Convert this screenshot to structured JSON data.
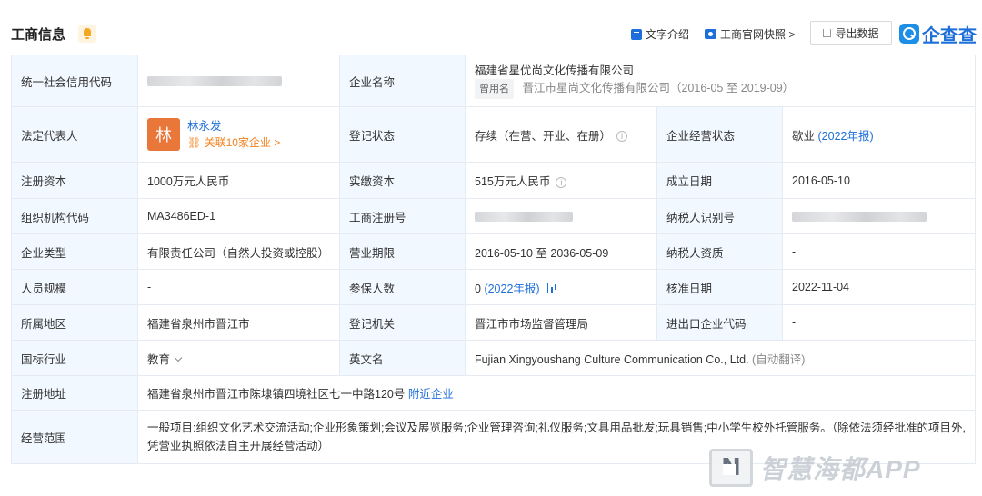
{
  "header": {
    "title": "工商信息",
    "links": {
      "text_intro": "文字介绍",
      "snapshot": "工商官网快照 >"
    },
    "export_label": "导出数据",
    "logo_text": "企查查"
  },
  "rows": {
    "credit_code_label": "统一社会信用代码",
    "company_name_label": "企业名称",
    "company_name": "福建省星优尚文化传播有限公司",
    "old_name_tag": "曾用名",
    "old_name": "晋江市星尚文化传播有限公司（2016-05 至 2019-09）",
    "legal_rep_label": "法定代表人",
    "legal_rep_avatar": "林",
    "legal_rep_name": "林永发",
    "legal_rep_related": "关联10家企业 >",
    "reg_status_label": "登记状态",
    "reg_status": "存续（在营、开业、在册）",
    "op_status_label": "企业经营状态",
    "op_status": "歇业",
    "op_status_year": "(2022年报)",
    "reg_capital_label": "注册资本",
    "reg_capital": "1000万元人民币",
    "paid_capital_label": "实缴资本",
    "paid_capital": "515万元人民币",
    "founded_label": "成立日期",
    "founded": "2016-05-10",
    "org_code_label": "组织机构代码",
    "org_code": "MA3486ED-1",
    "biz_reg_no_label": "工商注册号",
    "taxpayer_id_label": "纳税人识别号",
    "company_type_label": "企业类型",
    "company_type": "有限责任公司（自然人投资或控股）",
    "biz_term_label": "营业期限",
    "biz_term": "2016-05-10 至 2036-05-09",
    "taxpayer_qual_label": "纳税人资质",
    "taxpayer_qual": "-",
    "staff_size_label": "人员规模",
    "staff_size": "-",
    "insured_label": "参保人数",
    "insured_count": "0",
    "insured_year": "(2022年报)",
    "approval_date_label": "核准日期",
    "approval_date": "2022-11-04",
    "region_label": "所属地区",
    "region": "福建省泉州市晋江市",
    "reg_authority_label": "登记机关",
    "reg_authority": "晋江市市场监督管理局",
    "import_export_label": "进出口企业代码",
    "import_export": "-",
    "industry_label": "国标行业",
    "industry": "教育",
    "english_name_label": "英文名",
    "english_name": "Fujian Xingyoushang Culture Communication Co., Ltd.",
    "auto_translate": "(自动翻译)",
    "address_label": "注册地址",
    "address": "福建省泉州市晋江市陈埭镇四境社区七一中路120号",
    "nearby": "附近企业",
    "scope_label": "经营范围",
    "scope": "一般项目:组织文化艺术交流活动;企业形象策划;会议及展览服务;企业管理咨询;礼仪服务;文具用品批发;玩具销售;中小学生校外托管服务。（除依法须经批准的项目外,凭营业执照依法自主开展经营活动）"
  },
  "watermark": {
    "letter": "N",
    "text": "智慧海都APP"
  },
  "colors": {
    "accent": "#1e6fd9",
    "label_bg": "#f2f8ff",
    "border": "#e6ebf2",
    "avatar": "#e9773a",
    "related": "#f5811f",
    "bell": "#f5a623"
  }
}
